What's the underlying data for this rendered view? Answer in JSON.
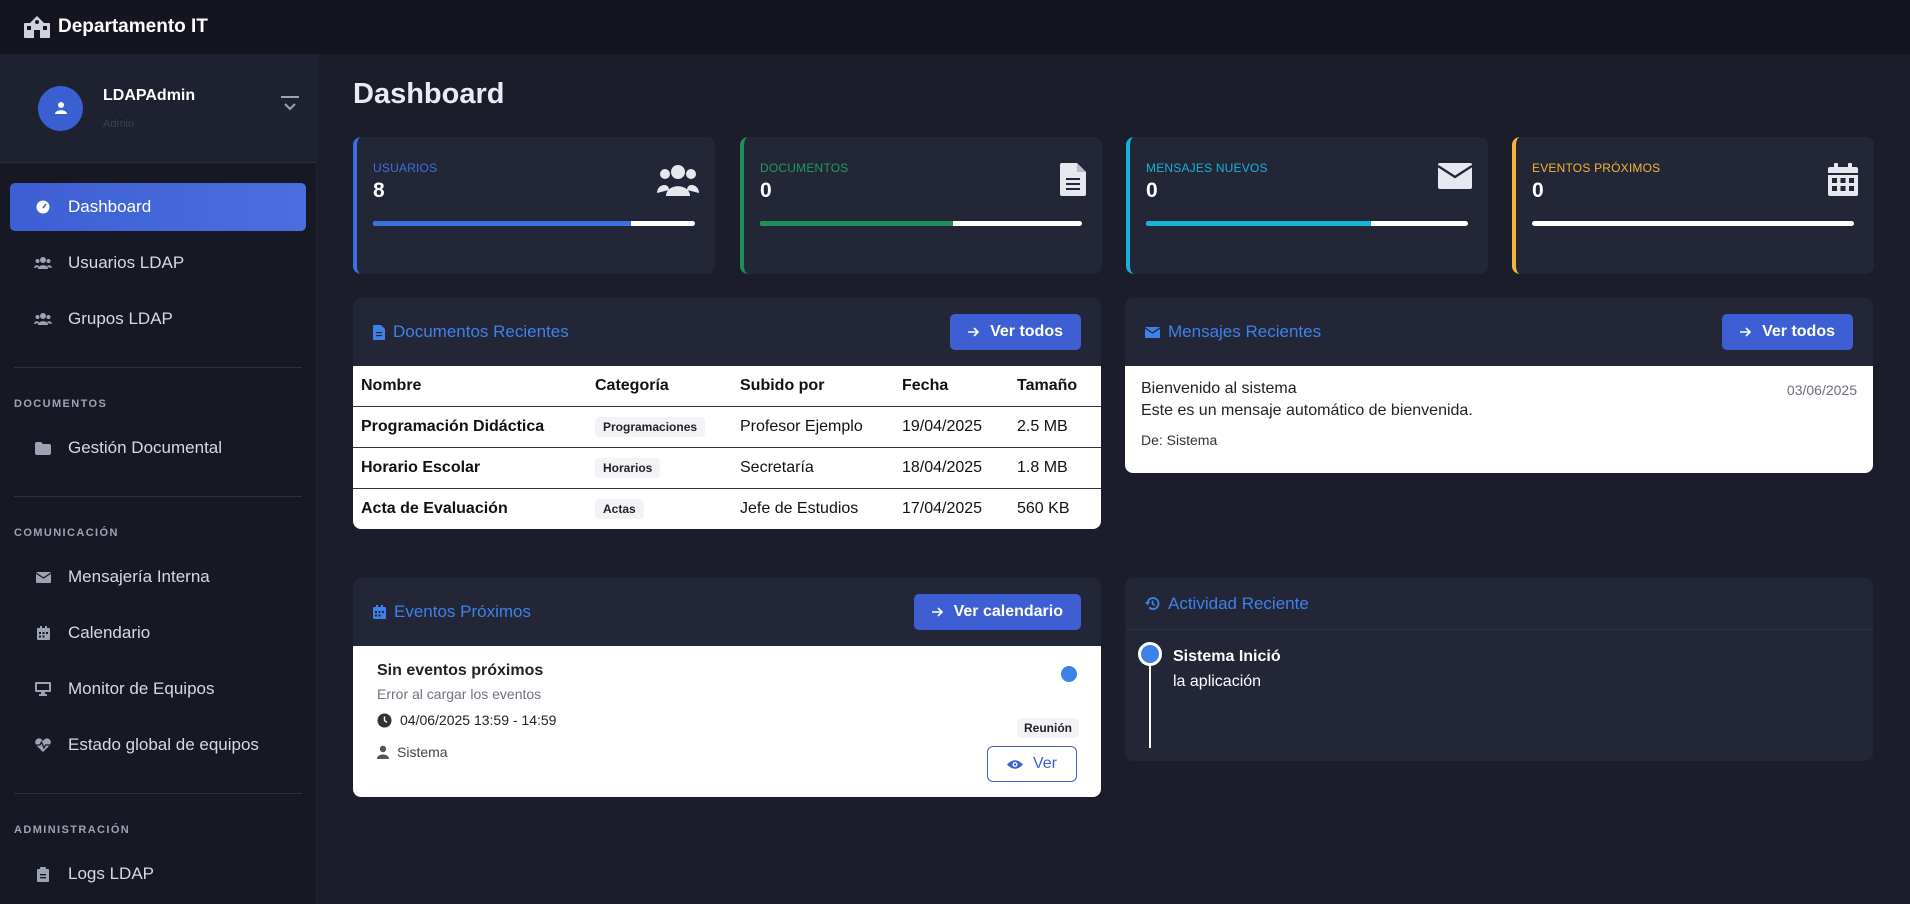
{
  "app": {
    "title": "Departamento IT"
  },
  "user": {
    "name": "LDAPAdmin",
    "role": "Admin"
  },
  "sidebar": {
    "main_items": [
      {
        "label": "Dashboard",
        "icon": "gauge-icon",
        "active": true
      },
      {
        "label": "Usuarios LDAP",
        "icon": "users-icon"
      },
      {
        "label": "Grupos LDAP",
        "icon": "users-icon"
      }
    ],
    "sections": [
      {
        "title": "DOCUMENTOS",
        "items": [
          {
            "label": "Gestión Documental",
            "icon": "folder-icon"
          }
        ]
      },
      {
        "title": "COMUNICACIÓN",
        "items": [
          {
            "label": "Mensajería Interna",
            "icon": "envelope-icon"
          },
          {
            "label": "Calendario",
            "icon": "calendar-icon"
          },
          {
            "label": "Monitor de Equipos",
            "icon": "monitor-icon"
          },
          {
            "label": "Estado global de equipos",
            "icon": "heartbeat-icon"
          }
        ]
      },
      {
        "title": "ADMINISTRACIÓN",
        "items": [
          {
            "label": "Logs LDAP",
            "icon": "clipboard-icon"
          }
        ]
      }
    ]
  },
  "page": {
    "title": "Dashboard"
  },
  "stats": [
    {
      "label": "USUARIOS",
      "value": "8",
      "color": "#3d6fe0",
      "progress": 0.8,
      "icon": "users-icon"
    },
    {
      "label": "DOCUMENTOS",
      "value": "0",
      "color": "#1f8f5a",
      "progress": 0.6,
      "icon": "file-icon"
    },
    {
      "label": "MENSAJES NUEVOS",
      "value": "0",
      "color": "#17b3d8",
      "progress": 0.7,
      "icon": "envelope-icon"
    },
    {
      "label": "EVENTOS PRÓXIMOS",
      "value": "0",
      "color": "#f2b53a",
      "progress": 0,
      "icon": "calendar-icon"
    }
  ],
  "documents": {
    "title": "Documentos Recientes",
    "button": "Ver todos",
    "columns": [
      "Nombre",
      "Categoría",
      "Subido por",
      "Fecha",
      "Tamaño"
    ],
    "rows": [
      {
        "name": "Programación Didáctica",
        "category": "Programaciones",
        "uploader": "Profesor Ejemplo",
        "date": "19/04/2025",
        "size": "2.5 MB"
      },
      {
        "name": "Horario Escolar",
        "category": "Horarios",
        "uploader": "Secretaría",
        "date": "18/04/2025",
        "size": "1.8 MB"
      },
      {
        "name": "Acta de Evaluación",
        "category": "Actas",
        "uploader": "Jefe de Estudios",
        "date": "17/04/2025",
        "size": "560 KB"
      }
    ]
  },
  "messages": {
    "title": "Mensajes Recientes",
    "button": "Ver todos",
    "items": [
      {
        "title": "Bienvenido al sistema",
        "date": "03/06/2025",
        "body": "Este es un mensaje automático de bienvenida.",
        "from": "De: Sistema"
      }
    ]
  },
  "events": {
    "title": "Eventos Próximos",
    "button": "Ver calendario",
    "item": {
      "title": "Sin eventos próximos",
      "subtitle": "Error al cargar los eventos",
      "time": "04/06/2025 13:59 - 14:59",
      "user": "Sistema",
      "tag": "Reunión",
      "action": "Ver"
    }
  },
  "activity": {
    "title": "Actividad Reciente",
    "items": [
      {
        "strong": "Sistema Inició",
        "text": "la aplicación"
      }
    ]
  }
}
